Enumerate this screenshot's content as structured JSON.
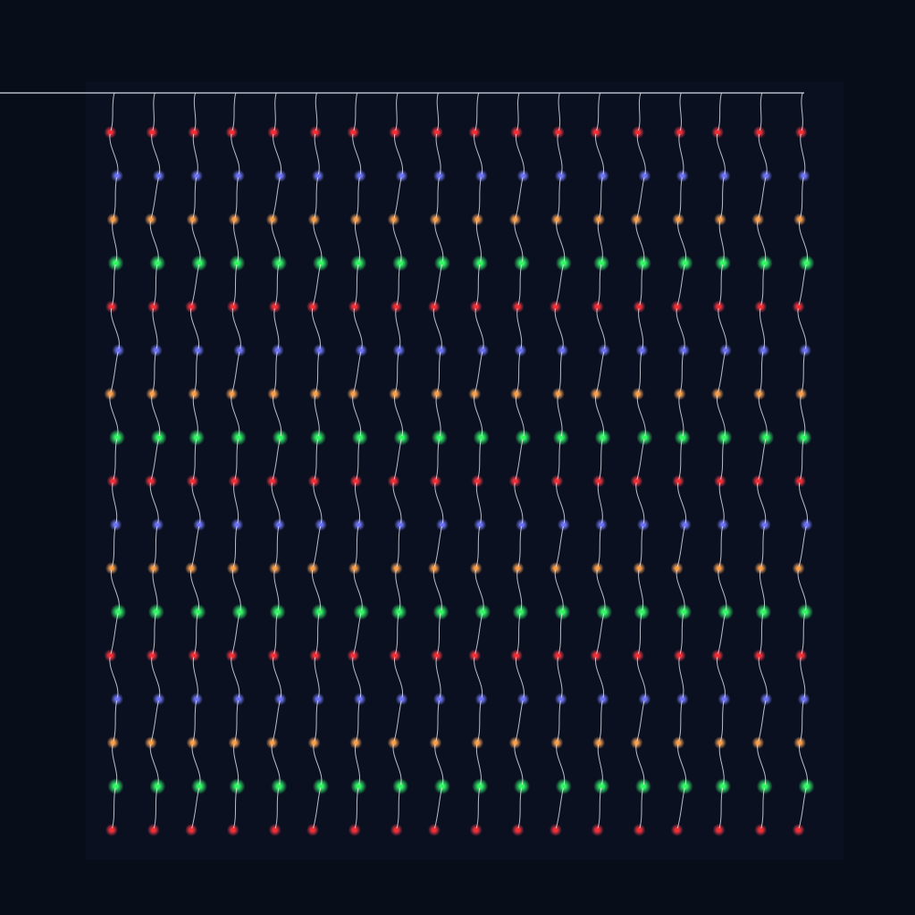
{
  "scene": {
    "subject": "led-curtain-light",
    "background_color": "#080d1a",
    "wire_color": "#d9dde6",
    "strand_count": 18,
    "bulbs_per_strand": 17,
    "color_cycle": [
      "red",
      "blue",
      "orange",
      "green"
    ],
    "colors": {
      "red": "#ff2b2b",
      "blue": "#6f74ff",
      "orange": "#ffa040",
      "green": "#2dff5a"
    }
  }
}
